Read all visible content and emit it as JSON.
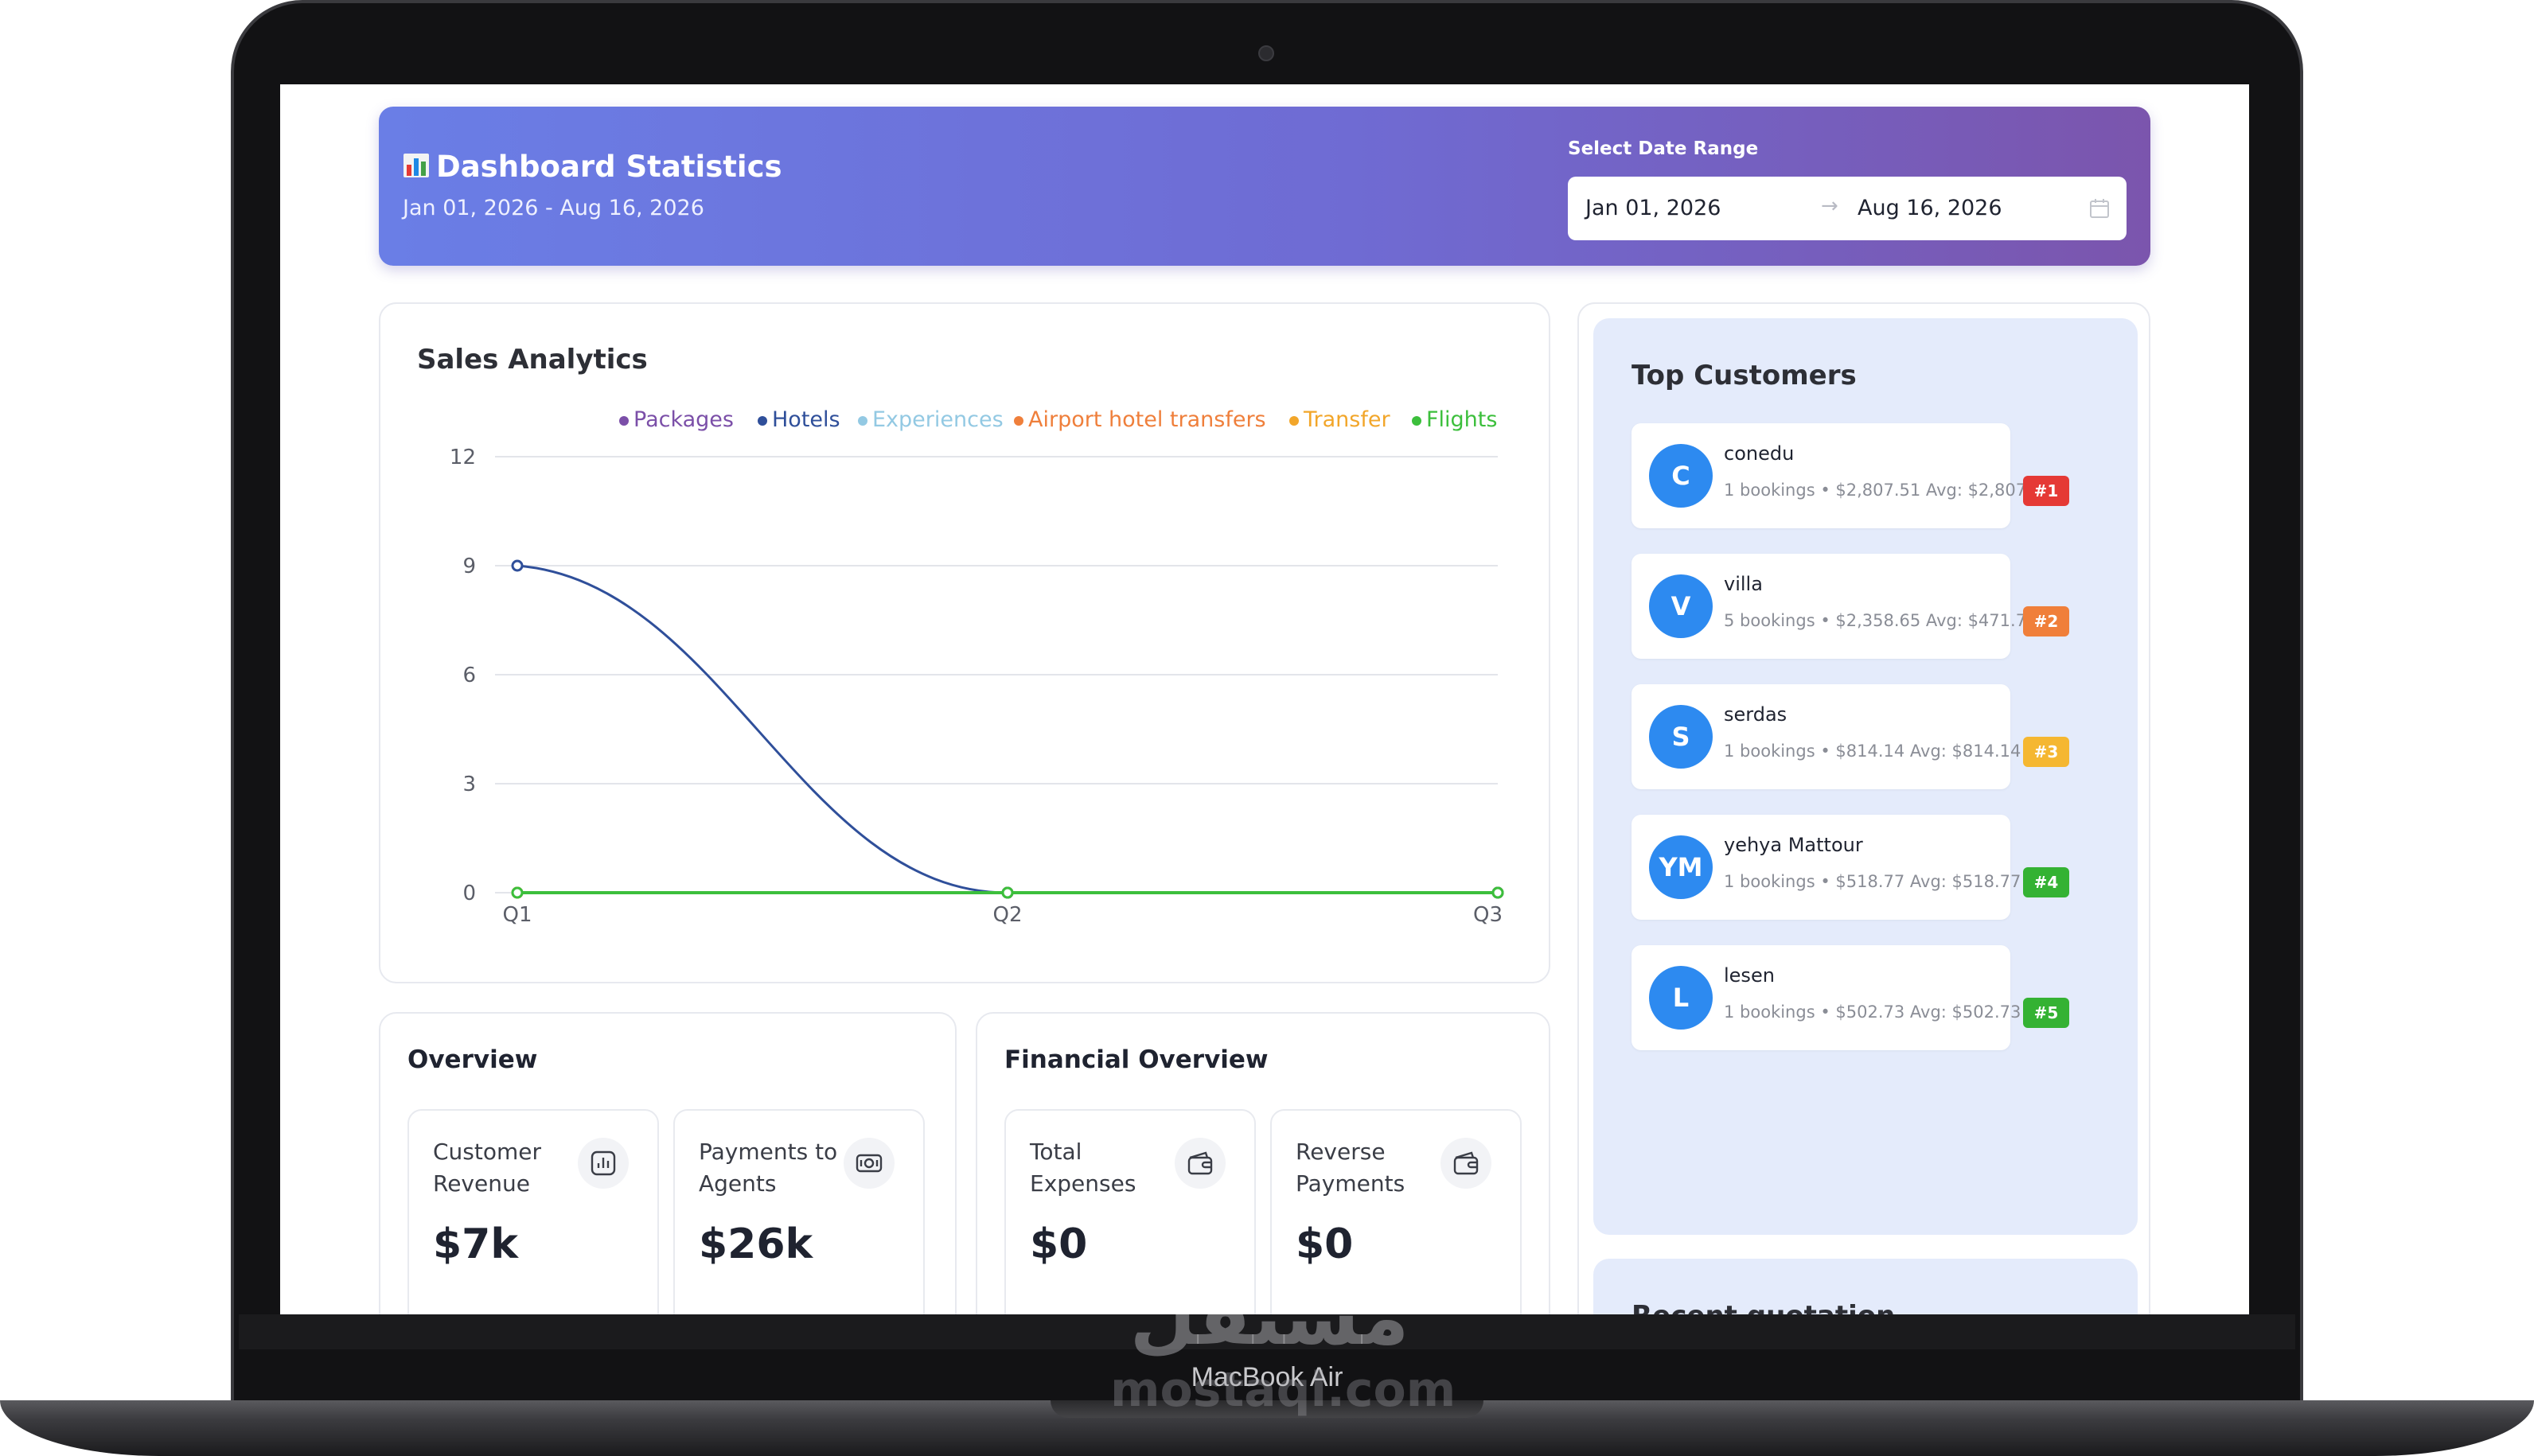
{
  "device": {
    "model_label": "MacBook Air",
    "watermark_arabic": "مستقل",
    "watermark_latin": "mostaql.com"
  },
  "header": {
    "icon": "bar-chart-icon",
    "title": "Dashboard Statistics",
    "subtitle": "Jan 01, 2026 - Aug 16, 2026",
    "range_label": "Select Date Range",
    "start_date": "Jan 01, 2026",
    "end_date": "Aug 16, 2026",
    "arrow": "→",
    "colors": {
      "gradient_start": "#6a7ee6",
      "gradient_end": "#7b55ad"
    }
  },
  "sales": {
    "title": "Sales Analytics",
    "legend": [
      {
        "name": "Packages",
        "color": "#7b4fa8"
      },
      {
        "name": "Hotels",
        "color": "#2f4f9a"
      },
      {
        "name": "Experiences",
        "color": "#93c9e3"
      },
      {
        "name": "Airport hotel transfers",
        "color": "#ef7f3b"
      },
      {
        "name": "Transfer",
        "color": "#f2a62a"
      },
      {
        "name": "Flights",
        "color": "#3cbf3c"
      }
    ]
  },
  "chart_data": {
    "type": "line",
    "title": "Sales Analytics",
    "categories": [
      "Q1",
      "Q2",
      "Q3"
    ],
    "yticks": [
      "0",
      "3",
      "6",
      "9",
      "12"
    ],
    "ylim": [
      0,
      12
    ],
    "grid": true,
    "legend_position": "top-right",
    "series": [
      {
        "name": "Packages",
        "values": [
          0,
          0,
          0
        ]
      },
      {
        "name": "Hotels",
        "values": [
          9,
          0,
          0
        ]
      },
      {
        "name": "Experiences",
        "values": [
          0,
          0,
          0
        ]
      },
      {
        "name": "Airport hotel transfers",
        "values": [
          0,
          0,
          0
        ]
      },
      {
        "name": "Transfer",
        "values": [
          0,
          0,
          0
        ]
      },
      {
        "name": "Flights",
        "values": [
          0,
          0,
          0
        ]
      }
    ]
  },
  "overview": {
    "title": "Overview",
    "cards": [
      {
        "label": "Customer Revenue",
        "value": "$7k",
        "icon": "bar-chart-icon"
      },
      {
        "label": "Payments to Agents",
        "value": "$26k",
        "icon": "money-icon"
      }
    ]
  },
  "financial": {
    "title": "Financial Overview",
    "cards": [
      {
        "label": "Total Expenses",
        "value": "$0",
        "icon": "wallet-icon"
      },
      {
        "label": "Reverse Payments",
        "value": "$0",
        "icon": "wallet-icon"
      }
    ]
  },
  "top_customers": {
    "title": "Top Customers",
    "items": [
      {
        "initials": "C",
        "name": "conedu",
        "meta": "1 bookings • $2,807.51   Avg: $2,807.51",
        "rank": "#1",
        "rank_color": "#e53935"
      },
      {
        "initials": "V",
        "name": "villa",
        "meta": "5 bookings • $2,358.65   Avg: $471.73",
        "rank": "#2",
        "rank_color": "#f07f3a"
      },
      {
        "initials": "S",
        "name": "serdas",
        "meta": "1 bookings • $814.14   Avg: $814.14",
        "rank": "#3",
        "rank_color": "#f5b731"
      },
      {
        "initials": "YM",
        "name": "yehya Mattour",
        "meta": "1 bookings • $518.77   Avg: $518.77",
        "rank": "#4",
        "rank_color": "#34b233"
      },
      {
        "initials": "L",
        "name": "lesen",
        "meta": "1 bookings • $502.73   Avg: $502.73",
        "rank": "#5",
        "rank_color": "#34b233"
      }
    ]
  },
  "recent_quotation": {
    "title": "Recent quotation"
  }
}
